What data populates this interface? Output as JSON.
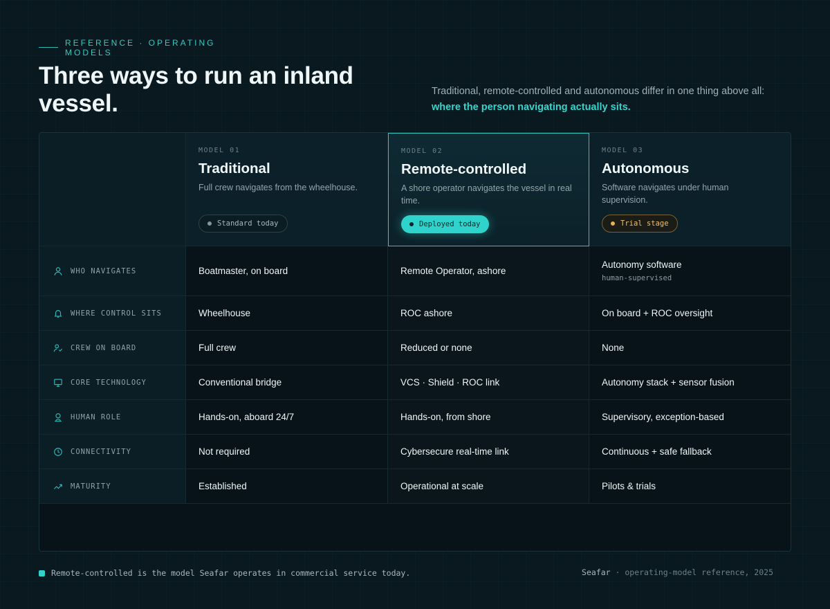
{
  "eyebrow": "REFERENCE · OPERATING MODELS",
  "title": "Three ways to run an inland vessel.",
  "intro": {
    "lead": "Traditional, remote-controlled and autonomous differ in one thing above all:",
    "highlight": "where the person navigating actually sits."
  },
  "models": [
    {
      "tag": "MODEL 01",
      "name": "Traditional",
      "desc": "Full crew navigates from the wheelhouse.",
      "badge": "Standard today"
    },
    {
      "tag": "MODEL 02",
      "name": "Remote-controlled",
      "desc": "A shore operator navigates the vessel in real time.",
      "badge": "Deployed today"
    },
    {
      "tag": "MODEL 03",
      "name": "Autonomous",
      "desc": "Software navigates under human supervision.",
      "badge": "Trial stage"
    }
  ],
  "rows": [
    {
      "label": "WHO NAVIGATES",
      "icon": "person-icon",
      "values": [
        "Boatmaster, on board",
        "Remote Operator, ashore",
        "Autonomy software"
      ],
      "sub": "human-supervised"
    },
    {
      "label": "WHERE CONTROL SITS",
      "icon": "bell-icon",
      "values": [
        "Wheelhouse",
        "ROC ashore",
        "On board + ROC oversight"
      ]
    },
    {
      "label": "CREW ON BOARD",
      "icon": "user-check-icon",
      "values": [
        "Full crew",
        "Reduced or none",
        "None"
      ]
    },
    {
      "label": "CORE TECHNOLOGY",
      "icon": "monitor-icon",
      "values": [
        "Conventional bridge",
        "VCS · Shield · ROC link",
        "Autonomy stack + sensor fusion"
      ]
    },
    {
      "label": "HUMAN ROLE",
      "icon": "person-pin-icon",
      "values": [
        "Hands-on, aboard 24/7",
        "Hands-on, from shore",
        "Supervisory, exception-based"
      ]
    },
    {
      "label": "CONNECTIVITY",
      "icon": "clock-icon",
      "values": [
        "Not required",
        "Cybersecure real-time link",
        "Continuous + safe fallback"
      ]
    },
    {
      "label": "MATURITY",
      "icon": "trend-up-icon",
      "values": [
        "Established",
        "Operational at scale",
        "Pilots & trials"
      ]
    }
  ],
  "footnote": "Remote-controlled is the model Seafar operates in commercial service today.",
  "credit": {
    "brand": "Seafar",
    "rest": " · operating-model reference, 2025"
  },
  "colors": {
    "accent": "#2fd3cb",
    "trial": "#e9b04f",
    "background": "#0a1820"
  }
}
